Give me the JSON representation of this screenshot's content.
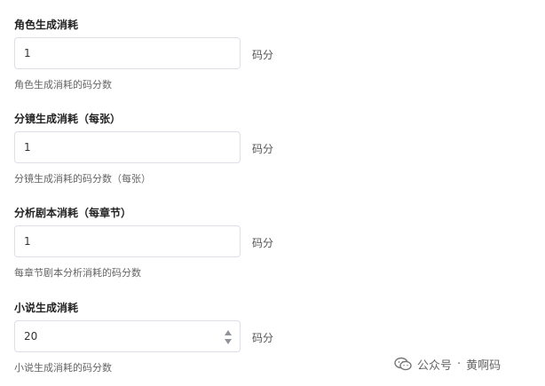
{
  "fields": [
    {
      "label": "角色生成消耗",
      "value": "1",
      "unit": "码分",
      "help": "角色生成消耗的码分数",
      "stepper": false
    },
    {
      "label": "分镜生成消耗（每张）",
      "value": "1",
      "unit": "码分",
      "help": "分镜生成消耗的码分数（每张）",
      "stepper": false
    },
    {
      "label": "分析剧本消耗（每章节）",
      "value": "1",
      "unit": "码分",
      "help": "每章节剧本分析消耗的码分数",
      "stepper": false
    },
    {
      "label": "小说生成消耗",
      "value": "20",
      "unit": "码分",
      "help": "小说生成消耗的码分数",
      "stepper": true
    }
  ],
  "watermark": {
    "prefix": "公众号",
    "separator": "·",
    "name": "黄啊码",
    "icon": "wechat-icon"
  }
}
